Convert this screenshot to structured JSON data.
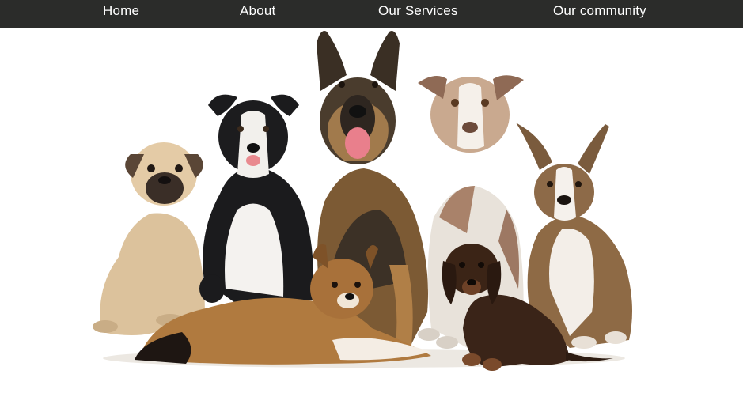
{
  "nav": {
    "items": [
      {
        "label": "Home"
      },
      {
        "label": "About"
      },
      {
        "label": "Our Services"
      },
      {
        "label": "Our community"
      }
    ]
  },
  "hero": {
    "image_subject": "group-of-dogs"
  },
  "colors": {
    "nav_bg": "#2b2c2a",
    "nav_text": "#ffffff",
    "page_bg": "#ffffff"
  }
}
